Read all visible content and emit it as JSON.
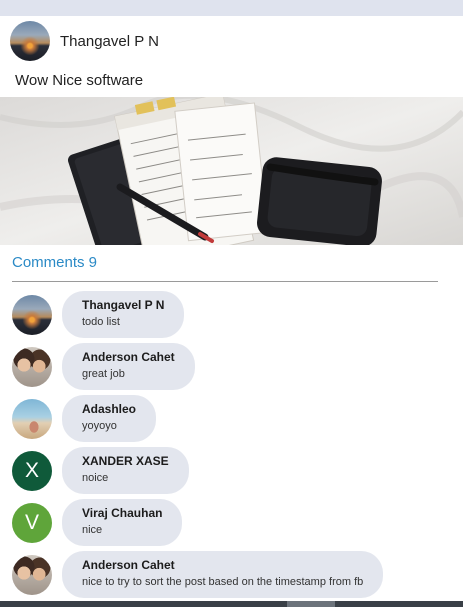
{
  "post": {
    "author": "Thangavel P N",
    "text": "Wow Nice software",
    "image_icon": "notebook-planner-photo"
  },
  "comments_label": "Comments 9",
  "comments": [
    {
      "author": "Thangavel P N",
      "text": "todo list",
      "avatar": "sunset-photo"
    },
    {
      "author": "Anderson Cahet",
      "text": "great job",
      "avatar": "two-people-photo"
    },
    {
      "author": "Adashleo",
      "text": "yoyoyo",
      "avatar": "beach-photo"
    },
    {
      "author": "XANDER XASE",
      "text": "noice",
      "avatar_letter": "X",
      "avatar_color": "#0f5a3a"
    },
    {
      "author": "Viraj Chauhan",
      "text": "nice",
      "avatar_letter": "V",
      "avatar_color": "#5fa53a"
    },
    {
      "author": "Anderson Cahet",
      "text": "nice to try to sort the post based on the timestamp from fb",
      "avatar": "two-people-photo"
    }
  ],
  "colors": {
    "accent": "#2b8ac6",
    "bubble": "#e3e6ee",
    "topbar": "#dfe3ee"
  }
}
